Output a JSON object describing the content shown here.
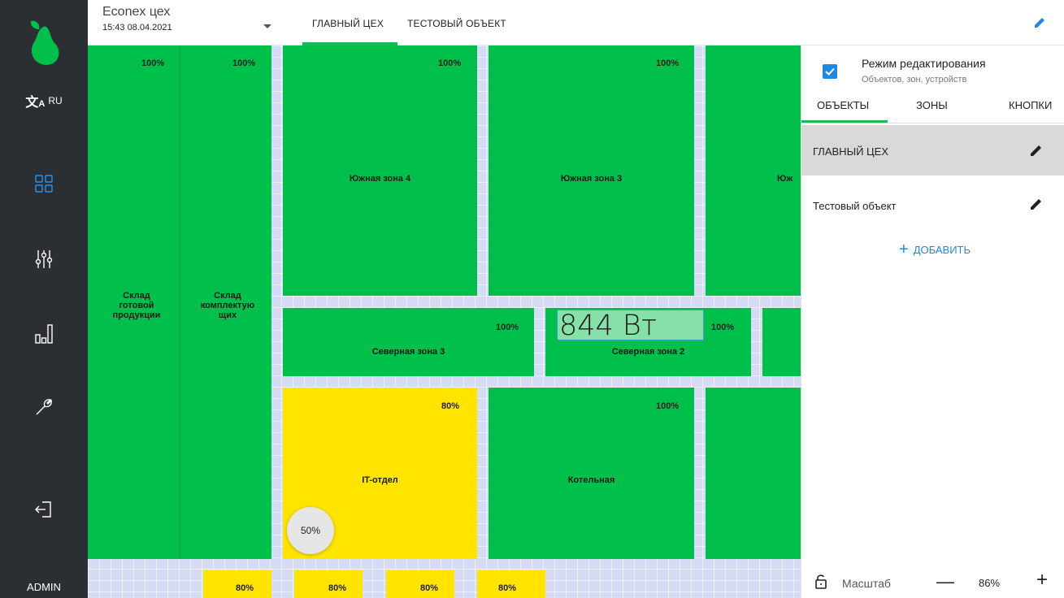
{
  "sidebar": {
    "language": "RU",
    "user": "ADMIN",
    "items": [
      {
        "icon": "grid-icon",
        "active": true
      },
      {
        "icon": "sliders-icon"
      },
      {
        "icon": "bar-chart-icon"
      },
      {
        "icon": "wrench-icon"
      },
      {
        "icon": "logout-icon"
      }
    ],
    "accent_color": "#2196f3"
  },
  "header": {
    "app_name": "Econex цех",
    "datetime": "15:43 08.04.2021",
    "tabs": [
      {
        "label": "ГЛАВНЫЙ ЦЕХ",
        "active": true
      },
      {
        "label": "ТЕСТОВЫЙ ОБЪЕКТ"
      }
    ]
  },
  "map": {
    "zones": [
      {
        "name": "Склад\nготовой\nпродукции",
        "percent": "100%",
        "status": "green"
      },
      {
        "name": "Склад\nкомплектую\nщих",
        "percent": "100%",
        "status": "green"
      },
      {
        "name": "Южная зона 4",
        "percent": "100%",
        "status": "green"
      },
      {
        "name": "Южная зона 3",
        "percent": "100%",
        "status": "green"
      },
      {
        "name": "Юж",
        "percent": "",
        "status": "green"
      },
      {
        "name": "Северная зона 3",
        "percent": "100%",
        "status": "green"
      },
      {
        "name": "Северная зона 2",
        "percent": "100%",
        "status": "green"
      },
      {
        "name": "IT-отдел",
        "percent": "80%",
        "status": "yellow"
      },
      {
        "name": "Котельная",
        "percent": "100%",
        "status": "green"
      }
    ],
    "bottom_zones": [
      {
        "percent": "80%"
      },
      {
        "percent": "80%"
      },
      {
        "percent": "80%"
      },
      {
        "percent": "80%"
      }
    ],
    "power_reading": "844 Вт",
    "circle_value": "50%",
    "colors": {
      "green": "#00c04b",
      "yellow": "#ffe400",
      "grid": "#d6dcf5"
    }
  },
  "panel": {
    "edit_mode": {
      "title": "Режим редактирования",
      "subtitle": "Объектов, зон, устройств",
      "checked": true
    },
    "tabs": [
      {
        "label": "ОБЪЕКТЫ",
        "active": true
      },
      {
        "label": "ЗОНЫ"
      },
      {
        "label": "КНОПКИ"
      }
    ],
    "objects": [
      {
        "label": "ГЛАВНЫЙ ЦЕХ",
        "selected": true
      },
      {
        "label": "Тестовый объект"
      }
    ],
    "add_label": "ДОБАВИТЬ",
    "zoom": {
      "label": "Масштаб",
      "value": "86%",
      "minus": "—",
      "plus": "+"
    }
  }
}
